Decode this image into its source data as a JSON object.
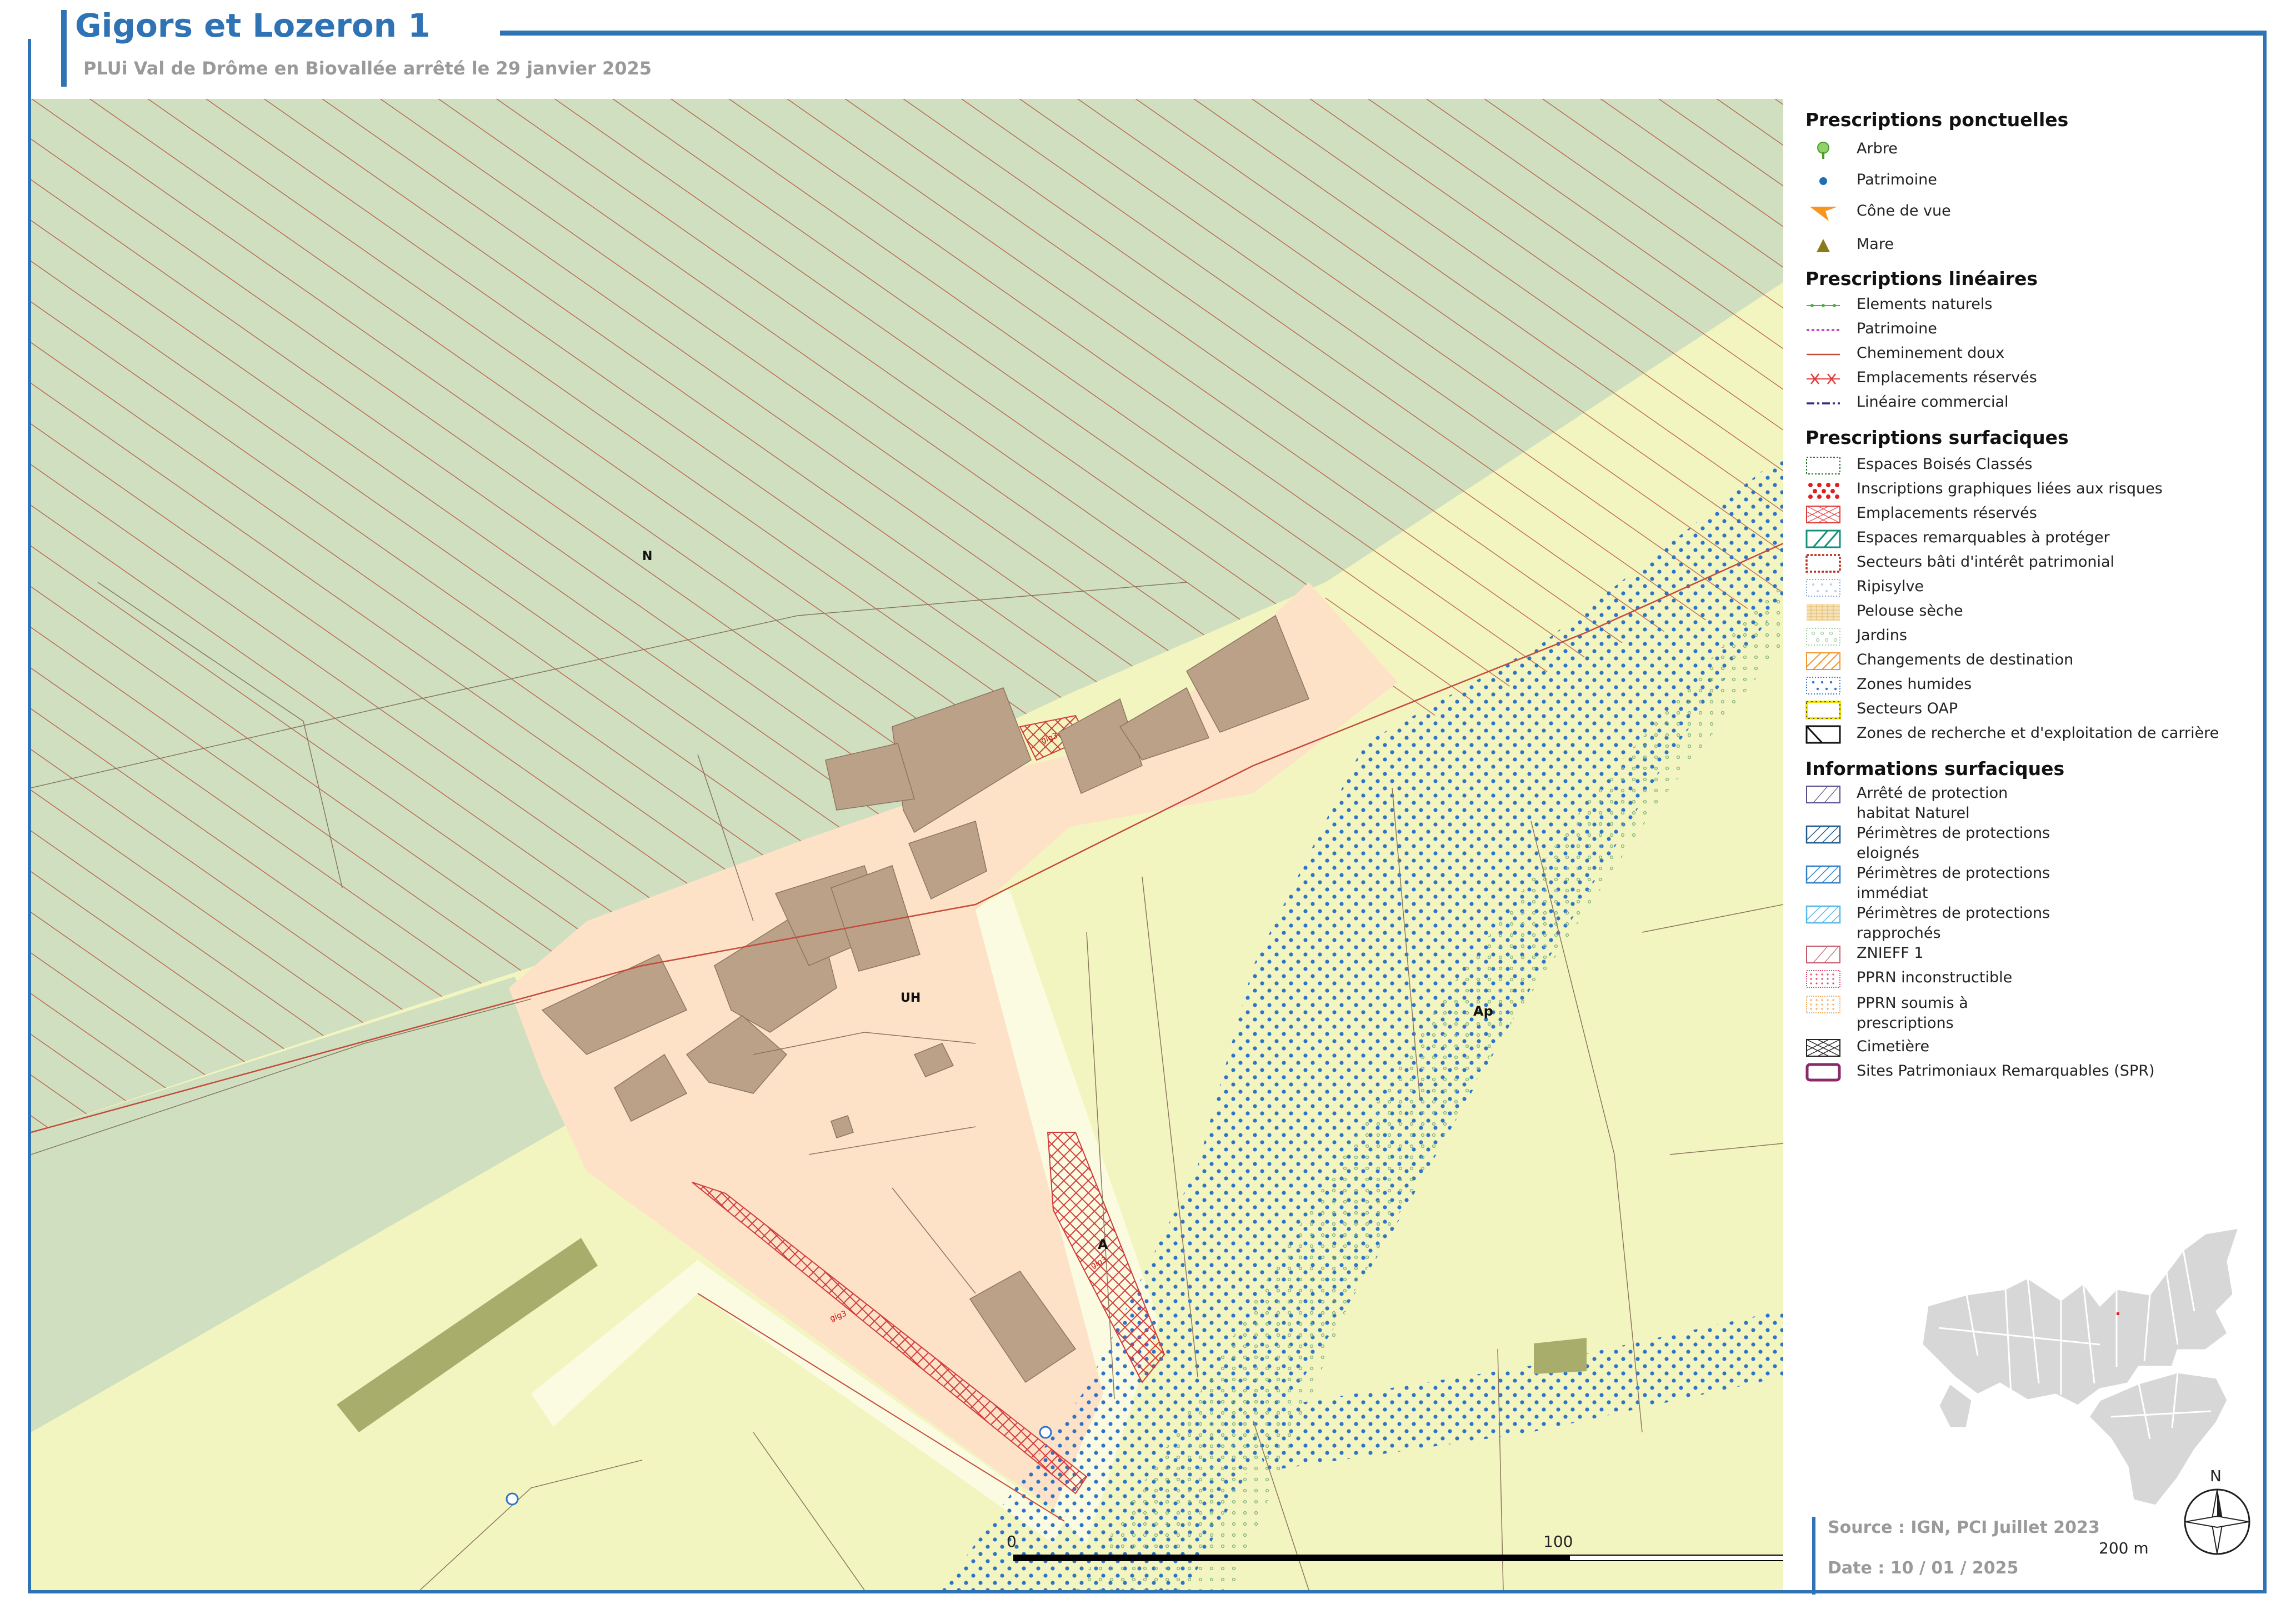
{
  "header": {
    "title": "Gigors et Lozeron 1",
    "subtitle": "PLUi Val de Drôme en Biovallée arrêté le 29 janvier 2025"
  },
  "map": {
    "zone_labels": [
      "N",
      "UH",
      "Ap",
      "A"
    ],
    "er_label": "gig3"
  },
  "legend": {
    "ponctuelles": {
      "title": "Prescriptions ponctuelles",
      "items": [
        "Arbre",
        "Patrimoine",
        "Cône de vue",
        "Mare"
      ]
    },
    "lineaires": {
      "title": "Prescriptions linéaires",
      "items": [
        "Elements naturels",
        "Patrimoine",
        "Cheminement doux",
        "Emplacements réservés",
        "Linéaire commercial"
      ]
    },
    "surfaciques": {
      "title": "Prescriptions surfaciques",
      "items": [
        "Espaces Boisés Classés",
        "Inscriptions graphiques liées aux risques",
        "Emplacements réservés",
        "Espaces remarquables à protéger",
        "Secteurs bâti d'intérêt patrimonial",
        "Ripisylve",
        "Pelouse sèche",
        "Jardins",
        "Changements de destination",
        "Zones humides",
        "Secteurs OAP",
        "Zones de recherche et d'exploitation de carrière"
      ]
    },
    "informations": {
      "title": "Informations surfaciques",
      "items": [
        "Arrêté de protection habitat Naturel",
        "Périmètres de protections eloignés",
        "Périmètres de protections immédiat",
        "Périmètres de protections rapprochés",
        "ZNIEFF 1",
        "PPRN inconstructible",
        "PPRN soumis à prescriptions",
        "Cimetière",
        "Sites Patrimoniaux Remarquables (SPR)"
      ]
    }
  },
  "footer": {
    "source": "Source : IGN, PCI Juillet 2023",
    "date": "Date : 10 / 01 / 2025"
  },
  "scale": {
    "labels": [
      "0",
      "100",
      "200 m"
    ]
  },
  "north": "N",
  "colors": {
    "accent": "#2f73b5",
    "zone_n": "#cfdfc0",
    "zone_a": "#f3f5c0",
    "zone_uh": "#fde2c8",
    "building": "#bba188",
    "hatch_red": "#d23b3b",
    "wetland_blue": "#2f73c9"
  }
}
